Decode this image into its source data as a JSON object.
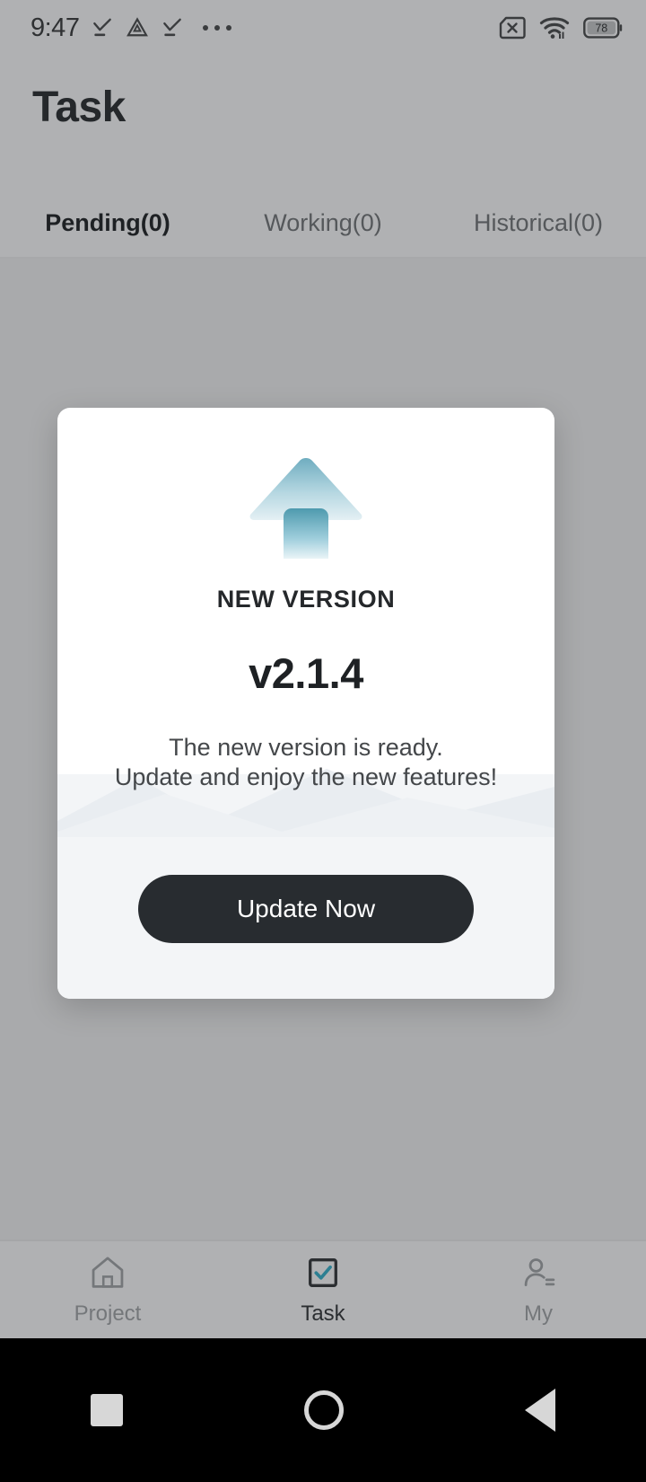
{
  "status_bar": {
    "time": "9:47",
    "left_icons": [
      "check-download-icon",
      "triangle-warning-icon",
      "check-download-icon",
      "more-dots-icon"
    ],
    "right_icons": [
      "sim-card-off-icon",
      "wifi-icon",
      "battery-icon"
    ],
    "battery_level": "78"
  },
  "header": {
    "title": "Task",
    "tabs": [
      {
        "label": "Pending(0)",
        "active": true
      },
      {
        "label": "Working(0)",
        "active": false
      },
      {
        "label": "Historical(0)",
        "active": false
      }
    ]
  },
  "dialog": {
    "icon": "upload-arrow-icon",
    "label": "NEW VERSION",
    "version": "v2.1.4",
    "description_line1": "The new version is ready.",
    "description_line2": "Update and enjoy the new features!",
    "primary_button": "Update Now"
  },
  "bottom_nav": [
    {
      "label": "Project",
      "icon": "home-icon",
      "active": false
    },
    {
      "label": "Task",
      "icon": "checkbox-check-icon",
      "active": true
    },
    {
      "label": "My",
      "icon": "person-icon",
      "active": false
    }
  ],
  "system_nav": {
    "recent": "square-recents-icon",
    "home": "circle-home-icon",
    "back": "triangle-back-icon"
  },
  "colors": {
    "scrim": "#a9aaac",
    "surface": "#b0b1b3",
    "dialog_bg": "#ffffff",
    "dialog_lower_bg": "#f3f5f7",
    "button_bg": "#282c30",
    "accent_teal": "#4e9aae",
    "text_primary": "#25282b",
    "text_secondary": "#55585b"
  }
}
